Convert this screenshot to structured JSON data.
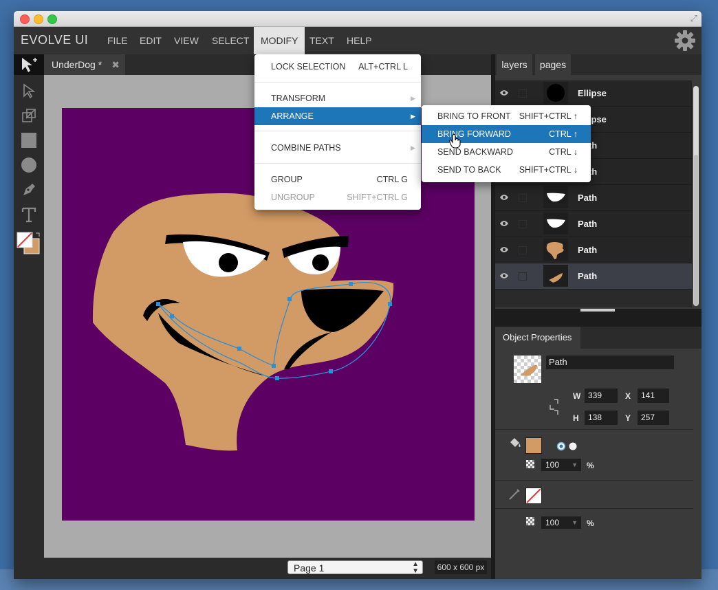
{
  "app": {
    "title": "EVOLVE UI"
  },
  "menubar": {
    "items": [
      "FILE",
      "EDIT",
      "VIEW",
      "SELECT",
      "MODIFY",
      "TEXT",
      "HELP"
    ]
  },
  "document": {
    "tab_label": "UnderDog *"
  },
  "modify_menu": {
    "lock_selection": {
      "label": "LOCK SELECTION",
      "shortcut": "ALT+CTRL L"
    },
    "transform": {
      "label": "TRANSFORM"
    },
    "arrange": {
      "label": "ARRANGE"
    },
    "combine_paths": {
      "label": "COMBINE PATHS"
    },
    "group": {
      "label": "GROUP",
      "shortcut": "CTRL G"
    },
    "ungroup": {
      "label": "UNGROUP",
      "shortcut": "SHIFT+CTRL G"
    }
  },
  "arrange_menu": {
    "bring_to_front": {
      "label": "BRING TO FRONT",
      "shortcut": "SHIFT+CTRL ↑"
    },
    "bring_forward": {
      "label": "BRING FORWARD",
      "shortcut": "CTRL ↑"
    },
    "send_backward": {
      "label": "SEND BACKWARD",
      "shortcut": "CTRL ↓"
    },
    "send_to_back": {
      "label": "SEND TO BACK",
      "shortcut": "SHIFT+CTRL ↓"
    }
  },
  "panel_tabs": {
    "layers": "layers",
    "pages": "pages"
  },
  "layers": [
    {
      "name": "Ellipse",
      "thumb": "ellipse"
    },
    {
      "name": "Ellipse",
      "thumb": "ellipse"
    },
    {
      "name": "Path",
      "thumb": "none"
    },
    {
      "name": "Path",
      "thumb": "none"
    },
    {
      "name": "Path",
      "thumb": "eye-white"
    },
    {
      "name": "Path",
      "thumb": "eye-white"
    },
    {
      "name": "Path",
      "thumb": "head"
    },
    {
      "name": "Path",
      "thumb": "mouth",
      "selected": true
    }
  ],
  "object_properties": {
    "tab_label": "Object Properties",
    "name": "Path",
    "w_label": "W",
    "w": "339",
    "h_label": "H",
    "h": "138",
    "x_label": "X",
    "x": "141",
    "y_label": "Y",
    "y": "257",
    "fill_color": "#d29a64",
    "fill_opacity": "100",
    "stroke_opacity": "100",
    "percent": "%"
  },
  "status": {
    "page_select": "Page 1",
    "canvas_size": "600 x 600 px"
  },
  "colors": {
    "artboard": "#5c0064",
    "skin": "#d29a64",
    "accent": "#1d76b8",
    "path_outline": "#2d8fd6"
  }
}
